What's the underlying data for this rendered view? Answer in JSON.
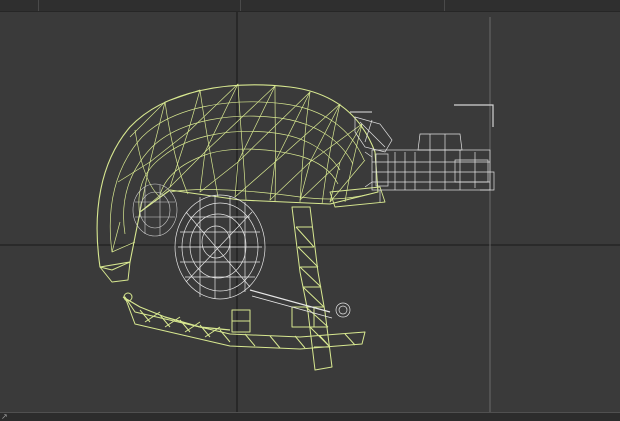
{
  "app": {
    "scene_object": "helmet-wireframe",
    "colors": {
      "viewport_bg": "#3a3a3a",
      "grid_line": "#1f1f1f",
      "helmet_wire": "#d8e890",
      "attachment_wire": "#e4e4e4",
      "selection_bracket": "#d0d0d0"
    }
  },
  "statusbar": {
    "corner_glyph": "↗"
  }
}
